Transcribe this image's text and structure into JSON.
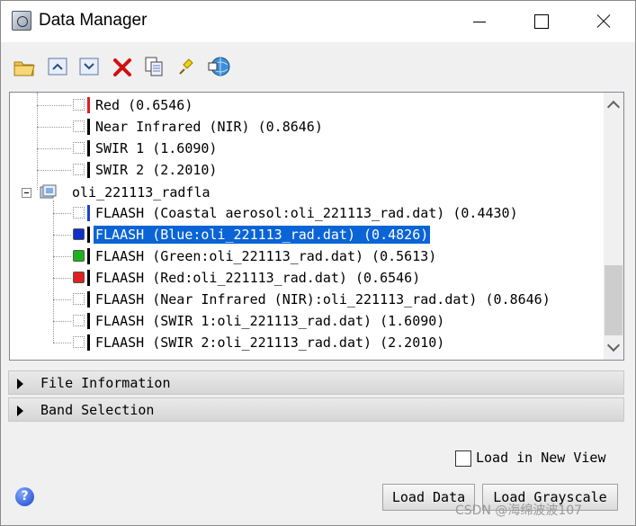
{
  "window": {
    "title": "Data Manager"
  },
  "toolbar": {
    "icons": [
      "open-folder-icon",
      "expand-up-icon",
      "collapse-down-icon",
      "delete-icon",
      "copy-icon",
      "pin-icon",
      "globe-link-icon"
    ]
  },
  "tree": {
    "top_rows": [
      {
        "label": "Red (0.6546)",
        "bar_color": "#e02020"
      },
      {
        "label": "Near Infrared (NIR) (0.8646)",
        "bar_color": "#000000"
      },
      {
        "label": "SWIR 1 (1.6090)",
        "bar_color": "#000000"
      },
      {
        "label": "SWIR 2 (2.2010)",
        "bar_color": "#000000"
      }
    ],
    "group_label": "oli_221113_radfla",
    "group_rows": [
      {
        "label": "FLAASH (Coastal aerosol:oli_221113_rad.dat) (0.4430)",
        "bar_color": "#2040d0",
        "swatch": ""
      },
      {
        "label": "FLAASH (Blue:oli_221113_rad.dat) (0.4826)",
        "bar_color": "#000000",
        "swatch": "#1030c8",
        "selected": true
      },
      {
        "label": "FLAASH (Green:oli_221113_rad.dat) (0.5613)",
        "bar_color": "#000000",
        "swatch": "#1fb21f"
      },
      {
        "label": "FLAASH (Red:oli_221113_rad.dat) (0.6546)",
        "bar_color": "#000000",
        "swatch": "#e02020"
      },
      {
        "label": "FLAASH (Near Infrared (NIR):oli_221113_rad.dat) (0.8646)",
        "bar_color": "#000000",
        "swatch": ""
      },
      {
        "label": "FLAASH (SWIR 1:oli_221113_rad.dat) (1.6090)",
        "bar_color": "#000000",
        "swatch": ""
      },
      {
        "label": "FLAASH (SWIR 2:oli_221113_rad.dat) (2.2010)",
        "bar_color": "#000000",
        "swatch": ""
      }
    ]
  },
  "sections": {
    "file_information": "File Information",
    "band_selection": "Band Selection"
  },
  "options": {
    "load_new_view_label": "Load in New View",
    "load_new_view_checked": false
  },
  "buttons": {
    "load_data": "Load Data",
    "load_grayscale": "Load Grayscale"
  },
  "watermark": "CSDN @海绵波波107",
  "colors": {
    "selection": "#0a64d6",
    "help": "#1f45c8"
  }
}
